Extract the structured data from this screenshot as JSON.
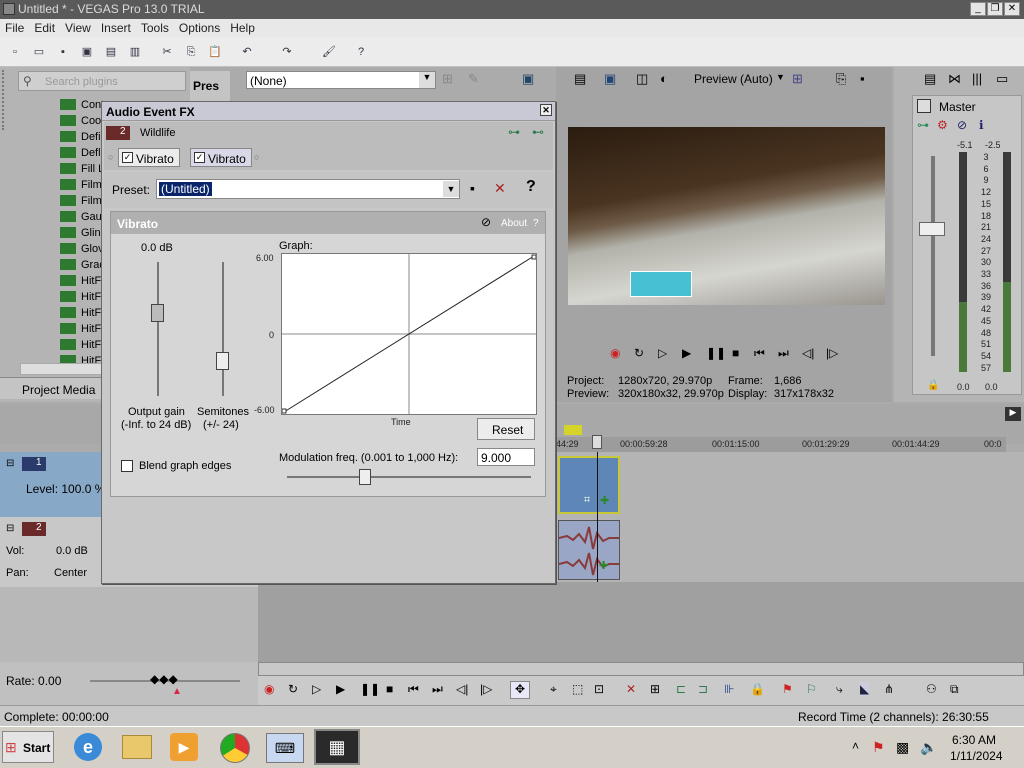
{
  "window": {
    "title": "Untitled * - VEGAS Pro 13.0 TRIAL"
  },
  "menu": [
    "File",
    "Edit",
    "View",
    "Insert",
    "Tools",
    "Options",
    "Help"
  ],
  "plugins": {
    "search_placeholder": "Search plugins",
    "items": [
      "Cont",
      "Coo",
      "Defi",
      "Defl",
      "Fill L",
      "Film",
      "Film",
      "Gau",
      "Glin",
      "Glov",
      "Grad",
      "HitF",
      "HitF",
      "HitF",
      "HitF",
      "HitF",
      "HitF"
    ],
    "tab": "Project Media"
  },
  "presets_header": "Pres",
  "preset_select": "(None)",
  "dialog": {
    "title": "Audio Event FX",
    "track_num": "2",
    "event_name": "Wildlife",
    "chain": [
      "Vibrato",
      "Vibrato"
    ],
    "preset_label": "Preset:",
    "preset_value": "(Untitled)",
    "section_title": "Vibrato",
    "about": "About",
    "help": "?",
    "gain_value": "0.0 dB",
    "output_gain_label": "Output gain",
    "output_gain_range": "(-Inf. to 24 dB)",
    "semitones_label": "Semitones",
    "semitones_range": "(+/- 24)",
    "graph_label": "Graph:",
    "graph_y_top": "6.00",
    "graph_y_mid": "0",
    "graph_y_bot": "-6.00",
    "graph_x_label": "Time",
    "reset": "Reset",
    "blend_label": "Blend graph edges",
    "mod_label": "Modulation freq. (0.001 to 1,000 Hz):",
    "mod_value": "9.000"
  },
  "preview": {
    "mode": "Preview (Auto)",
    "project_label": "Project:",
    "project_value": "1280x720, 29.970p",
    "preview_label": "Preview:",
    "preview_value": "320x180x32, 29.970p",
    "frame_label": "Frame:",
    "frame_value": "1,686",
    "display_label": "Display:",
    "display_value": "317x178x32"
  },
  "master": {
    "label": "Master",
    "peak_left": "-5.1",
    "peak_right": "-2.5",
    "scale": [
      "3",
      "6",
      "9",
      "12",
      "15",
      "18",
      "21",
      "24",
      "27",
      "30",
      "33",
      "36",
      "39",
      "42",
      "45",
      "48",
      "51",
      "54",
      "57"
    ],
    "bottom_left": "0.0",
    "bottom_right": "0.0"
  },
  "tracks": {
    "video": {
      "num": "1",
      "level": "Level: 100.0 %"
    },
    "audio": {
      "num": "2",
      "vol_label": "Vol:",
      "vol_value": "0.0 dB",
      "pan_label": "Pan:",
      "pan_value": "Center"
    }
  },
  "timeline": {
    "ruler": [
      "44:29",
      "00:00:59:28",
      "00:01:15:00",
      "00:01:29:29",
      "00:01:44:29",
      "00:0"
    ]
  },
  "rate": "Rate: 0.00",
  "status": {
    "complete": "Complete: 00:00:00",
    "record": "Record Time (2 channels): 26:30:55"
  },
  "taskbar": {
    "start": "Start",
    "time": "6:30 AM",
    "date": "1/11/2024"
  },
  "colors": {
    "accent": "#0a246a",
    "clip_video": "#5e86b6",
    "clip_border": "#c8c836",
    "waveform": "#8a3a3a"
  }
}
